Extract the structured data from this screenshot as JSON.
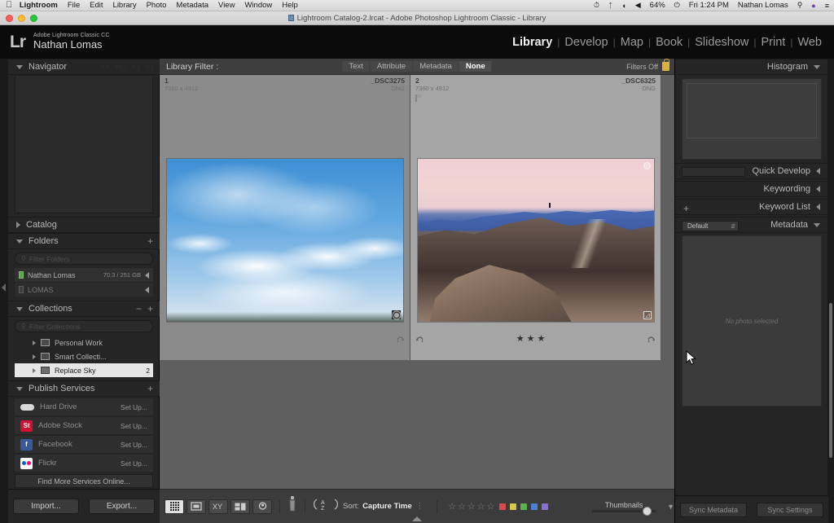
{
  "macbar": {
    "apple_icon": "apple-icon",
    "items": [
      "Lightroom",
      "File",
      "Edit",
      "Library",
      "Photo",
      "Metadata",
      "View",
      "Window",
      "Help"
    ],
    "right": {
      "time_machine_icon": "time-machine-icon",
      "bluetooth_icon": "bluetooth-icon",
      "wifi_icon": "wifi-icon",
      "volume_icon": "volume-icon",
      "battery_percent": "64%",
      "battery_icon": "battery-charging-icon",
      "clock": "Fri 1:24 PM",
      "user": "Nathan Lomas",
      "search_icon": "spotlight-search-icon",
      "siri_icon": "siri-icon",
      "notifications_icon": "notification-center-icon"
    }
  },
  "window": {
    "title": "Lightroom Catalog-2.lrcat - Adobe Photoshop Lightroom Classic - Library",
    "close_icon": "close-window-icon",
    "minimize_icon": "minimize-window-icon",
    "zoom_icon": "zoom-window-icon"
  },
  "identity": {
    "logo": "Lr",
    "product": "Adobe Lightroom Classic CC",
    "user": "Nathan Lomas"
  },
  "modules": [
    {
      "label": "Library",
      "active": true
    },
    {
      "label": "Develop",
      "active": false
    },
    {
      "label": "Map",
      "active": false
    },
    {
      "label": "Book",
      "active": false
    },
    {
      "label": "Slideshow",
      "active": false
    },
    {
      "label": "Print",
      "active": false
    },
    {
      "label": "Web",
      "active": false
    }
  ],
  "left_panel": {
    "navigator": {
      "title": "Navigator",
      "zoom_levels": [
        "FIT",
        "FILL",
        "1:1",
        "3:1"
      ]
    },
    "catalog": {
      "title": "Catalog"
    },
    "folders": {
      "title": "Folders",
      "filter_placeholder": "Filter Folders",
      "items": [
        {
          "name": "Nathan Lomas",
          "size": "70.3 / 251 GB",
          "selected": true
        },
        {
          "name": "LOMAS",
          "size": "",
          "selected": false
        }
      ]
    },
    "collections": {
      "title": "Collections",
      "filter_placeholder": "Filter Collections",
      "items": [
        {
          "name": "Personal Work",
          "count": "",
          "selected": false
        },
        {
          "name": "Smart Collecti...",
          "count": "",
          "selected": false
        },
        {
          "name": "Replace Sky",
          "count": "2",
          "selected": true
        }
      ]
    },
    "publish_services": {
      "title": "Publish Services",
      "items": [
        {
          "name": "Hard Drive",
          "action": "Set Up...",
          "icon": "hard-drive-icon"
        },
        {
          "name": "Adobe Stock",
          "action": "Set Up...",
          "icon": "adobe-stock-icon"
        },
        {
          "name": "Facebook",
          "action": "Set Up...",
          "icon": "facebook-icon"
        },
        {
          "name": "Flickr",
          "action": "Set Up...",
          "icon": "flickr-icon"
        }
      ],
      "find_more": "Find More Services Online..."
    },
    "buttons": {
      "import": "Import...",
      "export": "Export..."
    }
  },
  "library_filter": {
    "label": "Library Filter :",
    "tabs": [
      {
        "label": "Text",
        "active": false
      },
      {
        "label": "Attribute",
        "active": false
      },
      {
        "label": "Metadata",
        "active": false
      },
      {
        "label": "None",
        "active": true
      }
    ],
    "status": "Filters Off",
    "lock_icon": "lock-icon"
  },
  "grid": {
    "cells": [
      {
        "index": "1",
        "filename": "_DSC3275",
        "dimensions": "7360 x 4912",
        "filetype": "DNG",
        "selected": false,
        "stars": 0,
        "badges": [
          "develop-settings-badge"
        ],
        "photo": "sky-clouds"
      },
      {
        "index": "2",
        "filename": "_DSC6325",
        "dimensions": "7360 x 4912",
        "filetype": "DNG",
        "selected": true,
        "stars": 3,
        "badges": [
          "pick-flag-badge",
          "crop-badge"
        ],
        "photo": "desert-mountains-sunset"
      }
    ]
  },
  "right_panel": {
    "histogram": {
      "title": "Histogram"
    },
    "quick_develop": {
      "title": "Quick Develop"
    },
    "keywording": {
      "title": "Keywording"
    },
    "keyword_list": {
      "title": "Keyword List"
    },
    "metadata": {
      "title": "Metadata",
      "preset": "Default",
      "empty_message": "No photo selected"
    },
    "buttons": {
      "sync_metadata": "Sync Metadata",
      "sync_settings": "Sync Settings"
    }
  },
  "toolbar": {
    "view_buttons": [
      {
        "name": "grid-view-button",
        "active": true
      },
      {
        "name": "loupe-view-button",
        "active": false
      },
      {
        "name": "compare-view-button",
        "active": false
      },
      {
        "name": "survey-view-button",
        "active": false
      },
      {
        "name": "people-view-button",
        "active": false
      }
    ],
    "painter_icon": "spray-painter-icon",
    "sort_direction_icon": "sort-order-az-icon",
    "sort_label": "Sort:",
    "sort_value": "Capture Time",
    "rating_stars": 5,
    "color_labels": [
      "#d94b48",
      "#d6c94a",
      "#5fb04f",
      "#4a7fd1",
      "#8a6fd1"
    ],
    "thumbnails_label": "Thumbnails",
    "thumbnails_slider_value": 80
  }
}
